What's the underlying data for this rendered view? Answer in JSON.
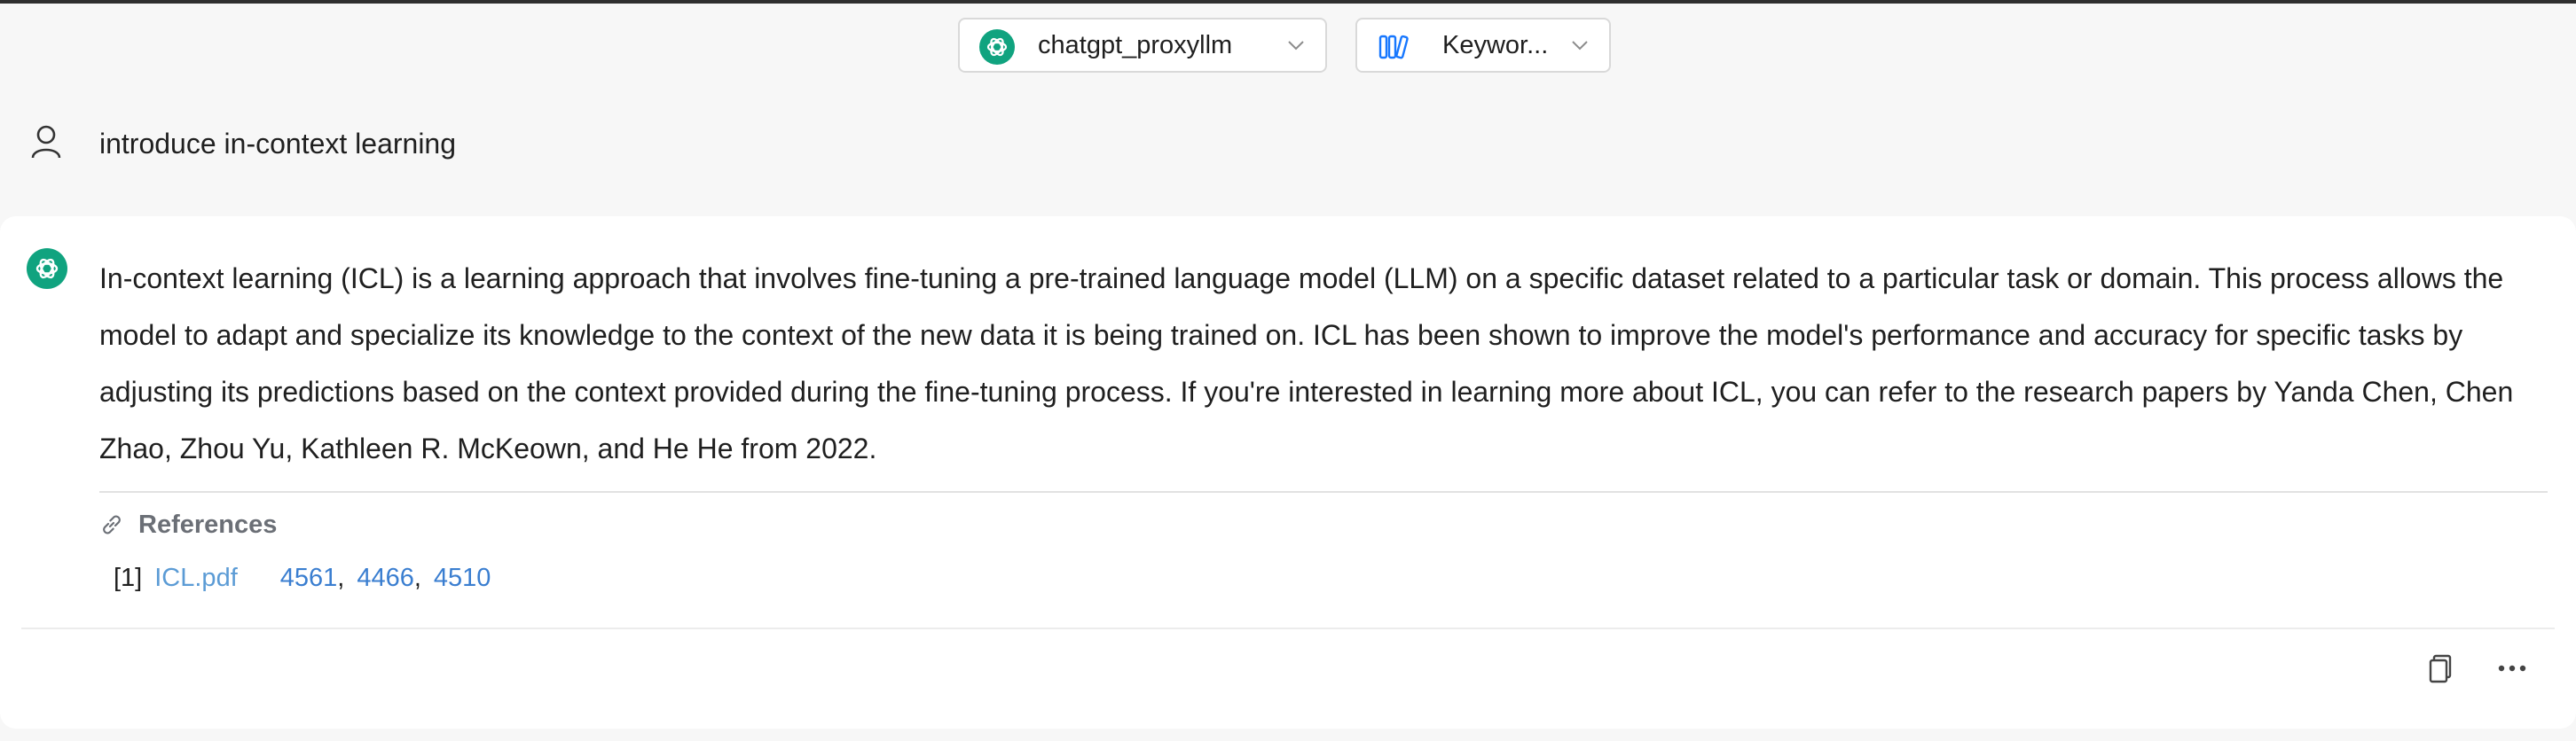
{
  "header": {
    "model_selector": {
      "value": "chatgpt_proxyllm",
      "icon": "openai-icon"
    },
    "mode_selector": {
      "value": "Keywor...",
      "icon": "knowledge-base-icon"
    }
  },
  "conversation": {
    "user_message": {
      "icon": "user-icon",
      "text": "introduce in-context learning"
    },
    "assistant_message": {
      "icon": "openai-icon",
      "text": "In-context learning (ICL) is a learning approach that involves fine-tuning a pre-trained language model (LLM) on a specific dataset related to a particular task or domain. This process allows the model to adapt and specialize its knowledge to the context of the new data it is being trained on. ICL has been shown to improve the model's performance and accuracy for specific tasks by adjusting its predictions based on the context provided during the fine-tuning process. If you're interested in learning more about ICL, you can refer to the research papers by Yanda Chen, Chen Zhao, Zhou Yu, Kathleen R. McKeown, and He He from 2022.",
      "references": {
        "title": "References",
        "items": [
          {
            "index": "[1]",
            "file": "ICL.pdf",
            "pages": [
              "4561",
              "4466",
              "4510"
            ]
          }
        ]
      },
      "actions": {
        "copy_icon": "copy-icon",
        "more_icon": "more-icon"
      }
    }
  },
  "colors": {
    "background": "#f7f7f7",
    "card": "#ffffff",
    "link": "#3a7ed0",
    "openai_green": "#10a37f",
    "muted_text": "#6b6f76"
  }
}
